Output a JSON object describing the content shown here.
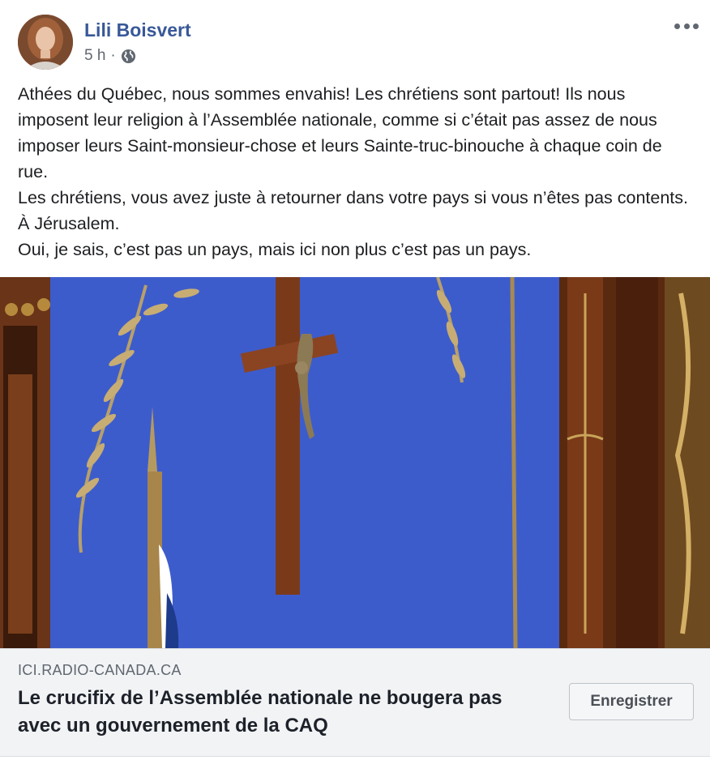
{
  "post": {
    "author": "Lili Boisvert",
    "time": "5 h",
    "separator": "·",
    "privacy_icon": "globe-icon",
    "menu_icon": "more-options-icon",
    "text_lines": [
      "Athées du Québec, nous sommes envahis! Les chrétiens sont partout! Ils nous imposent leur religion à l’Assemblée nationale, comme si c’était pas assez de nous imposer leurs Saint-monsieur-chose et leurs Sainte-truc-binouche à chaque coin de rue.",
      "Les chrétiens, vous avez juste à retourner dans votre pays si vous n’êtes pas contents. À Jérusalem.",
      "Oui, je sais, c’est pas un pays, mais ici non plus c’est pas un pays."
    ]
  },
  "link": {
    "domain": "ICI.RADIO-CANADA.CA",
    "title": "Le crucifix de l’Assemblée nationale ne bougera pas avec un gouvernement de la CAQ",
    "save_label": "Enregistrer",
    "image_description_icon": "crucifix-photo"
  },
  "colors": {
    "author_link": "#385898",
    "meta_text": "#606770",
    "footer_bg": "#f2f3f5",
    "wall_blue": "#3a56c4"
  }
}
